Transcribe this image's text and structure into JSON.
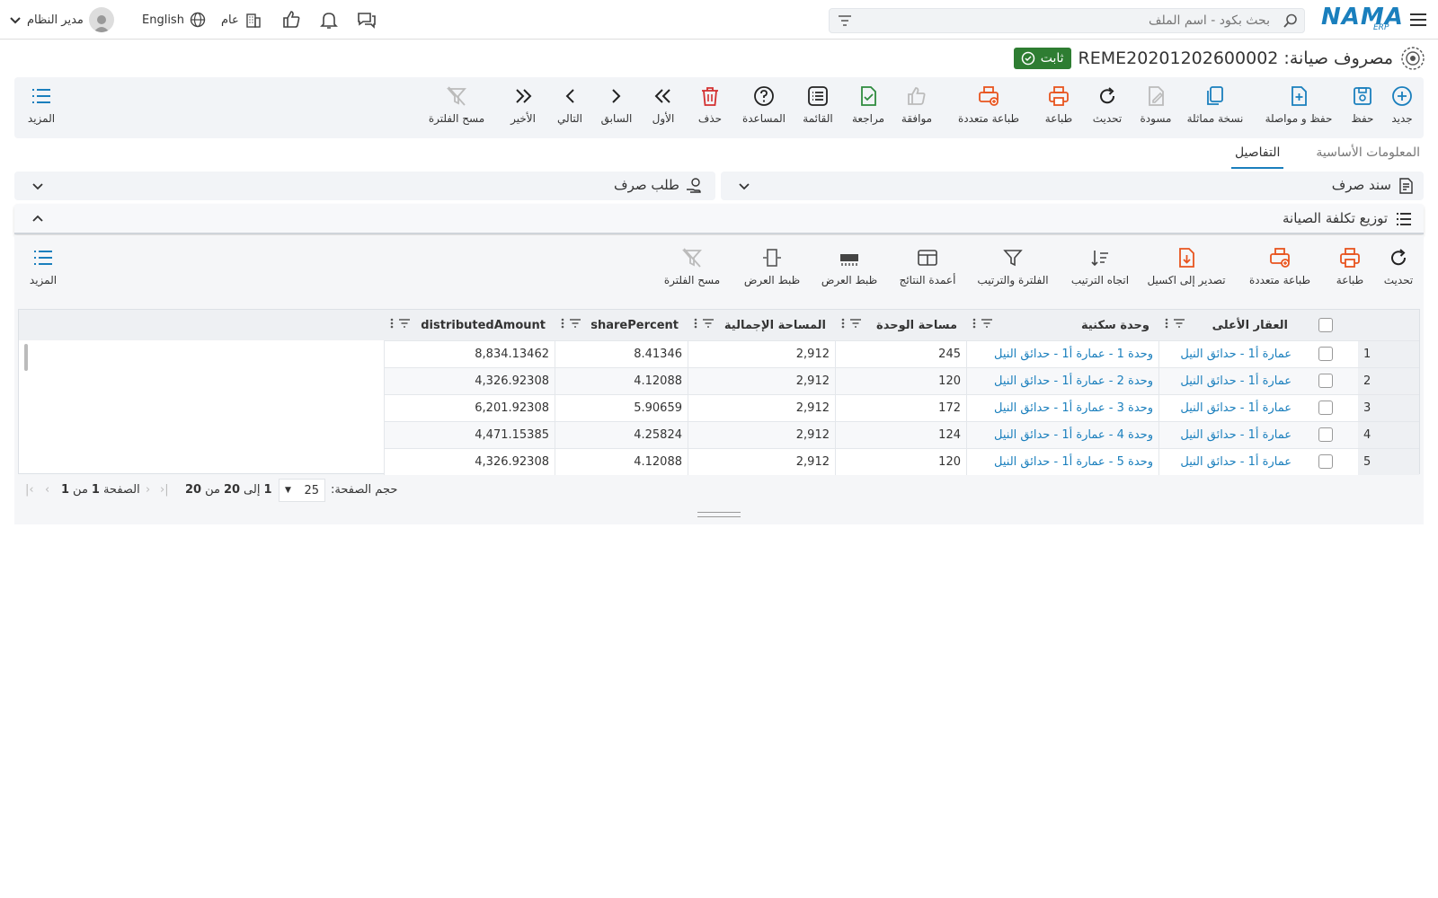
{
  "topbar": {
    "user_label": "مدير النظام",
    "language_label": "English",
    "branch_label": "عام",
    "search_placeholder": "بحث بكود - اسم الملف",
    "logo_text": "NAMA",
    "logo_sub": "ERP"
  },
  "header": {
    "title": "مصروف صيانة: REME20201202600002",
    "status_badge": "ثابت"
  },
  "toolbar": {
    "new": "جديد",
    "save": "حفظ",
    "save_continue": "حفظ و مواصلة",
    "duplicate": "نسخة مماثلة",
    "draft": "مسودة",
    "refresh": "تحديث",
    "print": "طباعة",
    "multi_print": "طباعة متعددة",
    "approve": "موافقة",
    "review": "مراجعة",
    "list": "القائمة",
    "help": "المساعدة",
    "delete": "حذف",
    "first": "الأول",
    "previous": "السابق",
    "next": "التالي",
    "last": "الأخير",
    "clear_filter": "مسح الفلترة",
    "more": "المزيد"
  },
  "tabs": [
    "المعلومات الأساسية",
    "التفاصيل"
  ],
  "panels": {
    "payment_voucher": "سند صرف",
    "payment_request": "طلب صرف",
    "distribution": "توزيع تكلفة الصيانة"
  },
  "grid_toolbar": {
    "refresh": "تحديث",
    "print": "طباعة",
    "multi_print": "طباعة متعددة",
    "export_excel": "تصدير إلى اكسيل",
    "sort_direction": "اتجاه الترتيب",
    "filter_sort": "الفلترة والترتيب",
    "result_columns": "أعمدة النتائج",
    "fit_width_1": "ظبط العرض",
    "fit_width_2": "ظبط العرض",
    "clear_filter": "مسح الفلترة",
    "more": "المزيد"
  },
  "grid": {
    "columns": [
      "العقار الأعلى",
      "وحدة سكنية",
      "مساحة الوحدة",
      "المساحة الإجمالية",
      "sharePercent",
      "distributedAmount"
    ],
    "rows": [
      {
        "n": "1",
        "parent": "عمارة أ1 - حدائق النيل",
        "unit": "وحدة 1 - عمارة أ1 - حدائق النيل",
        "unit_area": "245",
        "total_area": "2,912",
        "share": "8.41346",
        "amount": "8,834.13462"
      },
      {
        "n": "2",
        "parent": "عمارة أ1 - حدائق النيل",
        "unit": "وحدة 2 - عمارة أ1 - حدائق النيل",
        "unit_area": "120",
        "total_area": "2,912",
        "share": "4.12088",
        "amount": "4,326.92308"
      },
      {
        "n": "3",
        "parent": "عمارة أ1 - حدائق النيل",
        "unit": "وحدة 3 - عمارة أ1 - حدائق النيل",
        "unit_area": "172",
        "total_area": "2,912",
        "share": "5.90659",
        "amount": "6,201.92308"
      },
      {
        "n": "4",
        "parent": "عمارة أ1 - حدائق النيل",
        "unit": "وحدة 4 - عمارة أ1 - حدائق النيل",
        "unit_area": "124",
        "total_area": "2,912",
        "share": "4.25824",
        "amount": "4,471.15385"
      },
      {
        "n": "5",
        "parent": "عمارة أ1 - حدائق النيل",
        "unit": "وحدة 5 - عمارة أ1 - حدائق النيل",
        "unit_area": "120",
        "total_area": "2,912",
        "share": "4.12088",
        "amount": "4,326.92308"
      }
    ]
  },
  "pager": {
    "page_size_label": "حجم الصفحة:",
    "page_size": "25",
    "range_from": "1",
    "range_to_label": "إلى",
    "range_to": "20",
    "of_label": "من",
    "total": "20",
    "page_label": "الصفحة",
    "page": "1",
    "page_of_label": "من",
    "page_total": "1"
  },
  "colors": {
    "accent": "#1a7fbd",
    "print_orange": "#e8541e",
    "success": "#2e7d32"
  }
}
